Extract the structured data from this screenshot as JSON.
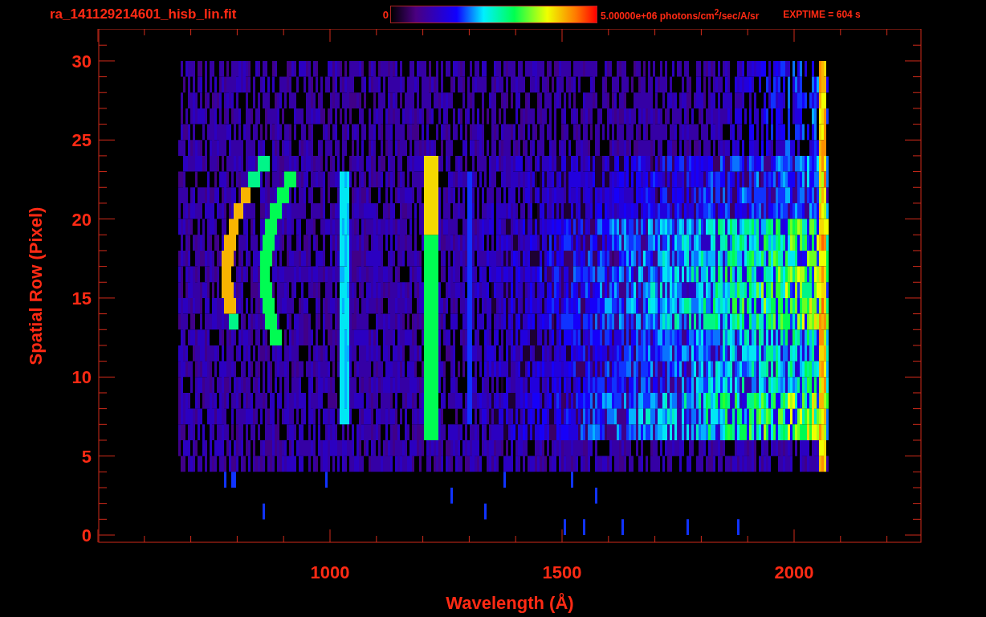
{
  "title": "ra_141129214601_hisb_lin.fit",
  "colorbar": {
    "min_label": "0",
    "max_label": "5.00000e+06 photons/cm$^{2}$/sec/A/sr"
  },
  "exposure": "EXPTIME = 604 s",
  "y_axis": {
    "label": "Spatial Row (Pixel)",
    "ticks": [
      "30",
      "25",
      "20",
      "15",
      "10",
      "5",
      "0"
    ]
  },
  "x_axis": {
    "label": "Wavelength (Å)",
    "ticks": [
      "1000",
      "1500",
      "2000"
    ]
  }
}
